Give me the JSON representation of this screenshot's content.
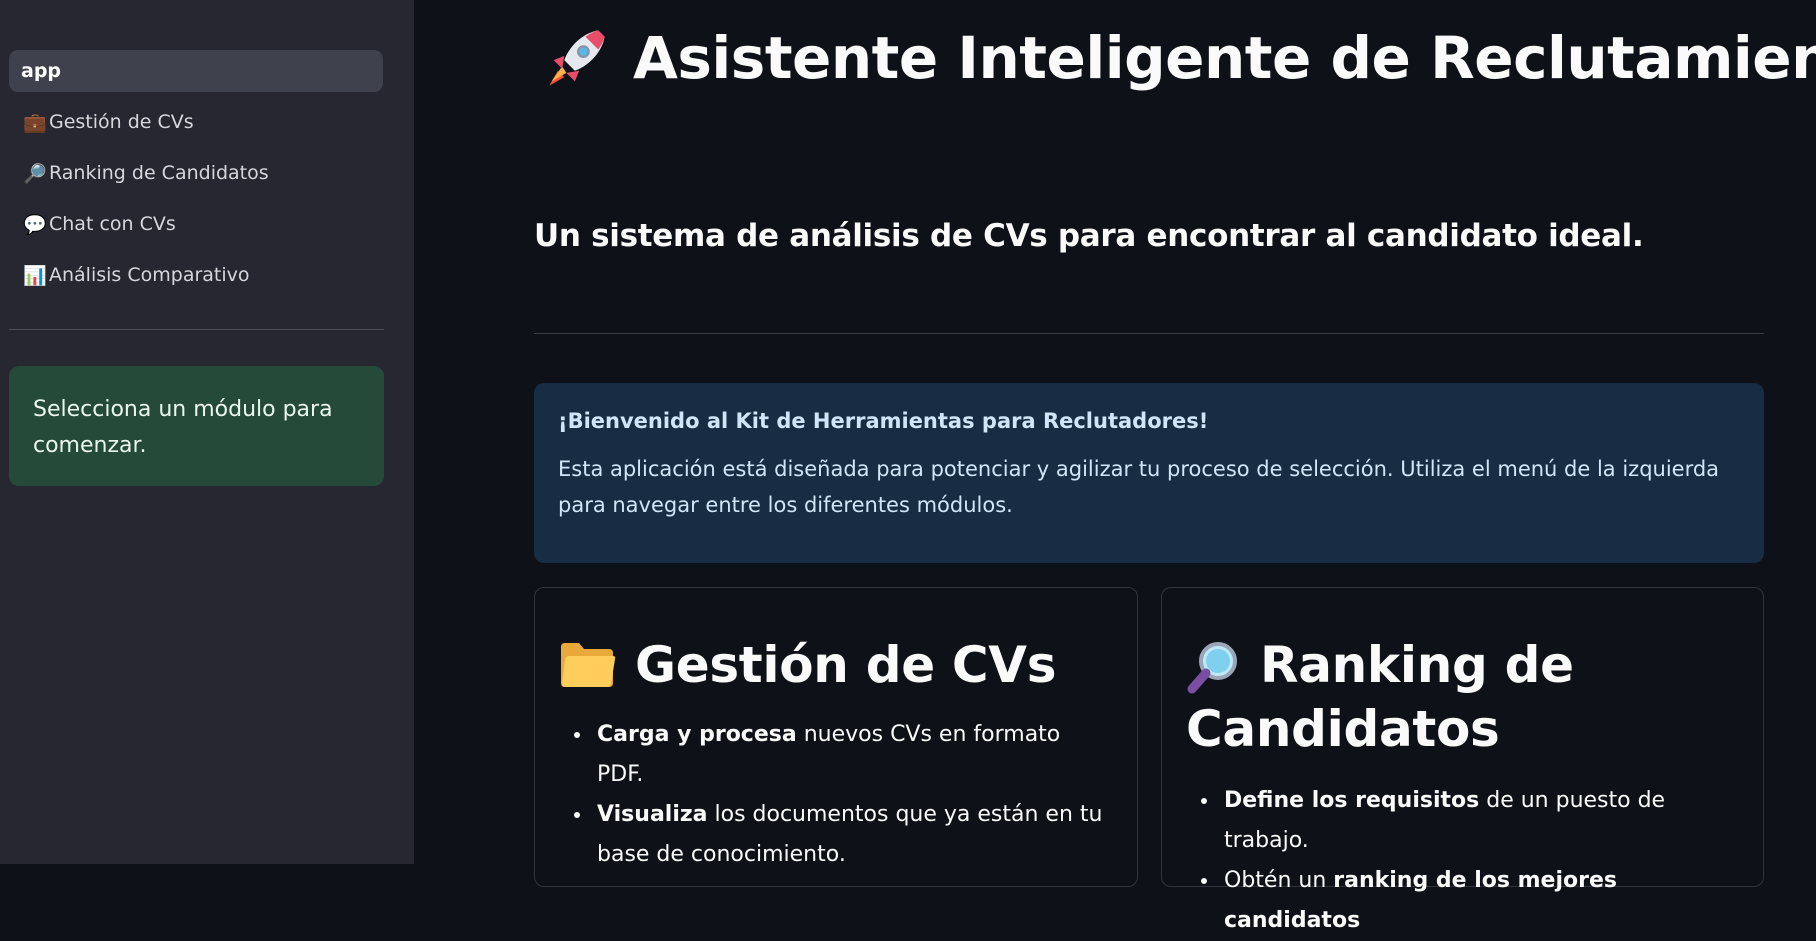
{
  "sidebar": {
    "items": [
      {
        "label": "app",
        "icon": "",
        "active": true
      },
      {
        "label": "Gestión de CVs",
        "icon": "briefcase-icon",
        "glyph": "💼"
      },
      {
        "label": "Ranking de Candidatos",
        "icon": "magnifier-icon",
        "glyph": "🔎"
      },
      {
        "label": "Chat con CVs",
        "icon": "speech-bubble-icon",
        "glyph": "💬"
      },
      {
        "label": "Análisis Comparativo",
        "icon": "bar-chart-icon",
        "glyph": "📊"
      }
    ],
    "info": "Selecciona un módulo para comenzar."
  },
  "main": {
    "title": "Asistente Inteligente de Reclutamiento",
    "title_icon": "rocket-icon",
    "subtitle": "Un sistema de análisis de CVs para encontrar al candidato ideal.",
    "welcome": {
      "title": "¡Bienvenido al Kit de Herramientas para Reclutadores!",
      "body": "Esta aplicación está diseñada para potenciar y agilizar tu proceso de selección. Utiliza el menú de la izquierda para navegar entre los diferentes módulos."
    },
    "cards": [
      {
        "title": "Gestión de CVs",
        "icon": "folder-icon",
        "bullets": [
          {
            "bold": "Carga y procesa",
            "text": " nuevos CVs en formato PDF."
          },
          {
            "bold": "Visualiza",
            "text": " los documentos que ya están en tu base de conocimiento."
          }
        ]
      },
      {
        "title_line1": "Ranking de",
        "title_line2": "Candidatos",
        "icon": "magnifier-icon",
        "bullets": [
          {
            "bold": "Define los requisitos",
            "text": " de un puesto de trabajo."
          },
          {
            "pre": "Obtén un ",
            "bold": "ranking de los mejores candidatos"
          }
        ]
      }
    ]
  },
  "colors": {
    "background": "#0e1117",
    "sidebar": "#262730",
    "success_box": "#264a3a",
    "info_box": "#172d43"
  }
}
